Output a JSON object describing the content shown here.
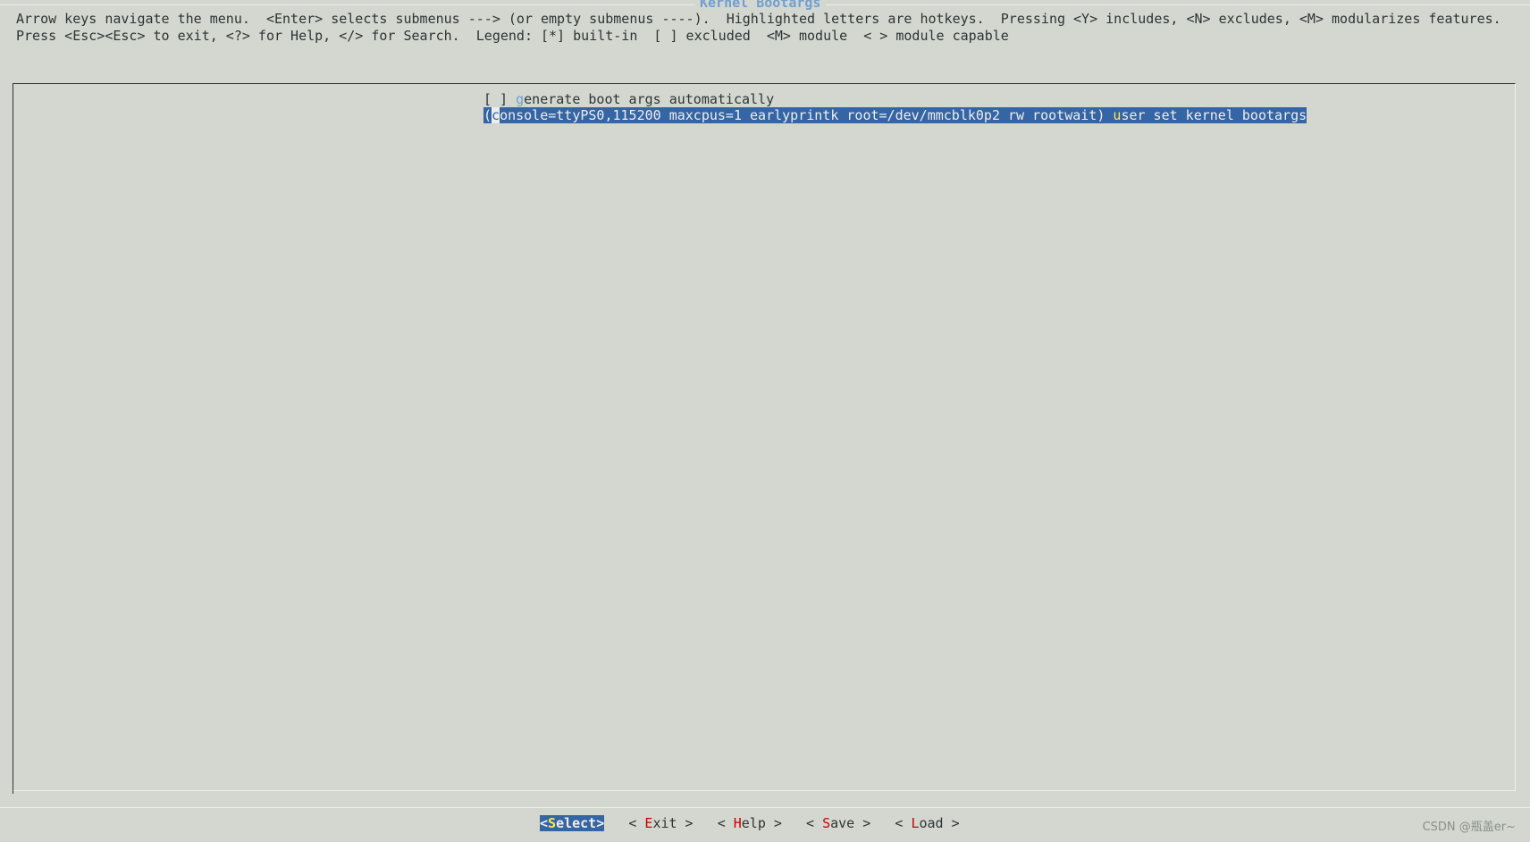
{
  "window": {
    "title": "Kernel Bootargs"
  },
  "help": {
    "line1": "Arrow keys navigate the menu.  <Enter> selects submenus ---> (or empty submenus ----).  Highlighted letters are hotkeys.  Pressing <Y> includes, <N> excludes, <M> modularizes features.",
    "line2": "Press <Esc><Esc> to exit, <?> for Help, </> for Search.  Legend: [*] built-in  [ ] excluded  <M> module  < > module capable"
  },
  "menu": {
    "items": [
      {
        "prefix": "[ ] ",
        "hotkey": "g",
        "rest": "enerate boot args automatically",
        "selected": false
      },
      {
        "prefix": "(",
        "cursor_char": "c",
        "value_rest": "onsole=ttyPS0,115200 maxcpus=1 earlyprintk root=/dev/mmcblk0p2 rw rootwait) ",
        "hotkey": "u",
        "rest": "ser set kernel bootargs",
        "selected": true
      }
    ]
  },
  "buttons": {
    "select": {
      "open": "<",
      "hotkey": "S",
      "rest": "elect",
      "close": ">"
    },
    "exit": {
      "open": "< ",
      "hotkey": "E",
      "rest": "xit",
      "close": " >"
    },
    "help": {
      "open": "< ",
      "hotkey": "H",
      "rest": "elp",
      "close": " >"
    },
    "save": {
      "open": "< ",
      "hotkey": "S",
      "rest": "ave",
      "close": " >"
    },
    "load": {
      "open": "< ",
      "hotkey": "L",
      "rest": "oad",
      "close": " >"
    }
  },
  "watermark": "CSDN @瓶盖er~",
  "colors": {
    "background": "#d3d7cf",
    "selection": "#3465a4",
    "title": "#729fcf",
    "hotkey_red": "#cc0000",
    "hotkey_yellow": "#fce94f"
  }
}
